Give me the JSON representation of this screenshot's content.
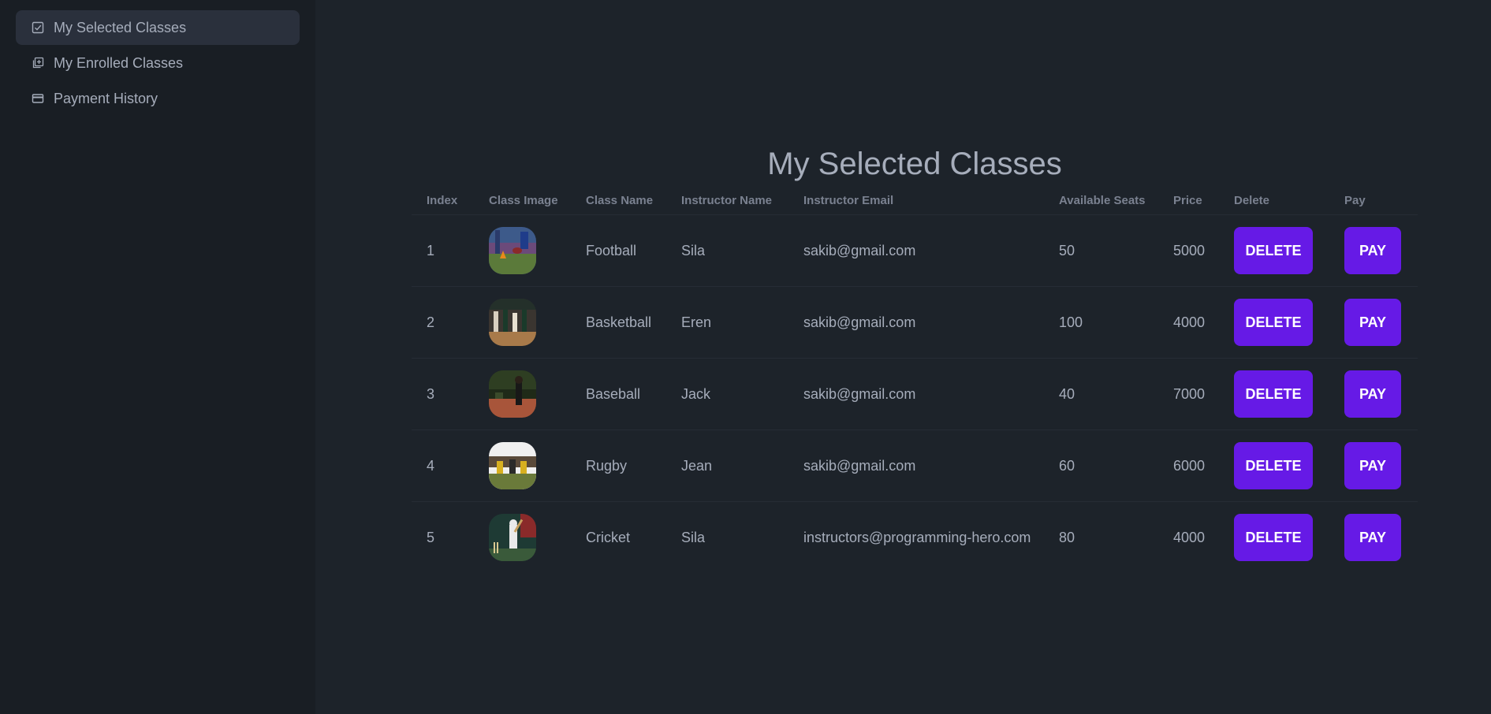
{
  "sidebar": {
    "items": [
      {
        "label": "My Selected Classes",
        "icon": "checkbox-icon",
        "active": true
      },
      {
        "label": "My Enrolled Classes",
        "icon": "add-collection-icon",
        "active": false
      },
      {
        "label": "Payment History",
        "icon": "credit-card-icon",
        "active": false
      }
    ]
  },
  "main": {
    "title": "My Selected Classes",
    "table": {
      "headers": [
        "Index",
        "Class Image",
        "Class Name",
        "Instructor Name",
        "Instructor Email",
        "Available Seats",
        "Price",
        "Delete",
        "Pay"
      ],
      "rows": [
        {
          "index": "1",
          "class_name": "Football",
          "instructor": "Sila",
          "email": "sakib@gmail.com",
          "seats": "50",
          "price": "5000",
          "delete_label": "DELETE",
          "pay_label": "PAY"
        },
        {
          "index": "2",
          "class_name": "Basketball",
          "instructor": "Eren",
          "email": "sakib@gmail.com",
          "seats": "100",
          "price": "4000",
          "delete_label": "DELETE",
          "pay_label": "PAY"
        },
        {
          "index": "3",
          "class_name": "Baseball",
          "instructor": "Jack",
          "email": "sakib@gmail.com",
          "seats": "40",
          "price": "7000",
          "delete_label": "DELETE",
          "pay_label": "PAY"
        },
        {
          "index": "4",
          "class_name": "Rugby",
          "instructor": "Jean",
          "email": "sakib@gmail.com",
          "seats": "60",
          "price": "6000",
          "delete_label": "DELETE",
          "pay_label": "PAY"
        },
        {
          "index": "5",
          "class_name": "Cricket",
          "instructor": "Sila",
          "email": "instructors@programming-hero.com",
          "seats": "80",
          "price": "4000",
          "delete_label": "DELETE",
          "pay_label": "PAY"
        }
      ]
    }
  },
  "colors": {
    "background": "#1d232a",
    "sidebar": "#191e24",
    "active_item": "#2a303c",
    "primary_button": "#661ae6",
    "text": "#a6adbb"
  }
}
